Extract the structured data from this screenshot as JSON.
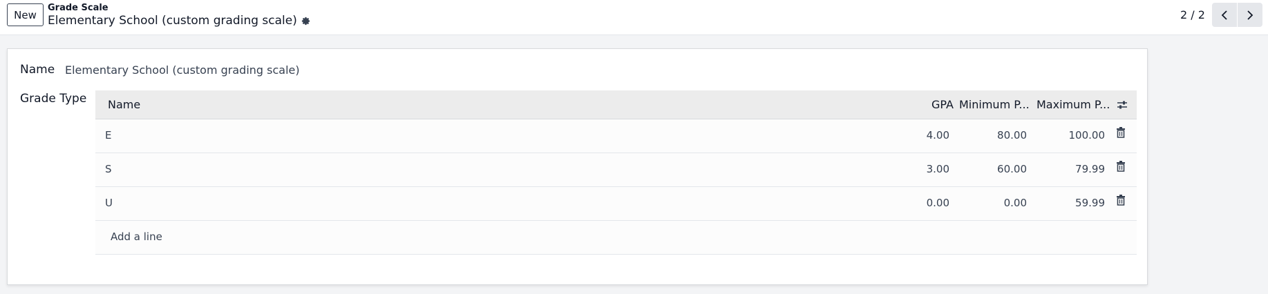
{
  "control_panel": {
    "new_button": "New",
    "breadcrumb_parent": "Grade Scale",
    "record_title": "Elementary School (custom grading scale)",
    "pager": "2 / 2"
  },
  "form": {
    "name_label": "Name",
    "name_value": "Elementary School (custom grading scale)",
    "grade_type_label": "Grade Type"
  },
  "grade_table": {
    "columns": [
      "Name",
      "GPA",
      "Minimum P...",
      "Maximum P..."
    ],
    "rows": [
      {
        "name": "E",
        "gpa": "4.00",
        "min": "80.00",
        "max": "100.00"
      },
      {
        "name": "S",
        "gpa": "3.00",
        "min": "60.00",
        "max": "79.99"
      },
      {
        "name": "U",
        "gpa": "0.00",
        "min": "0.00",
        "max": "59.99"
      }
    ],
    "add_line": "Add a line"
  },
  "icons": {
    "gear": "gear-icon",
    "prev": "chevron-left-icon",
    "next": "chevron-right-icon",
    "delete": "trash-icon",
    "optional_columns": "sliders-icon"
  }
}
